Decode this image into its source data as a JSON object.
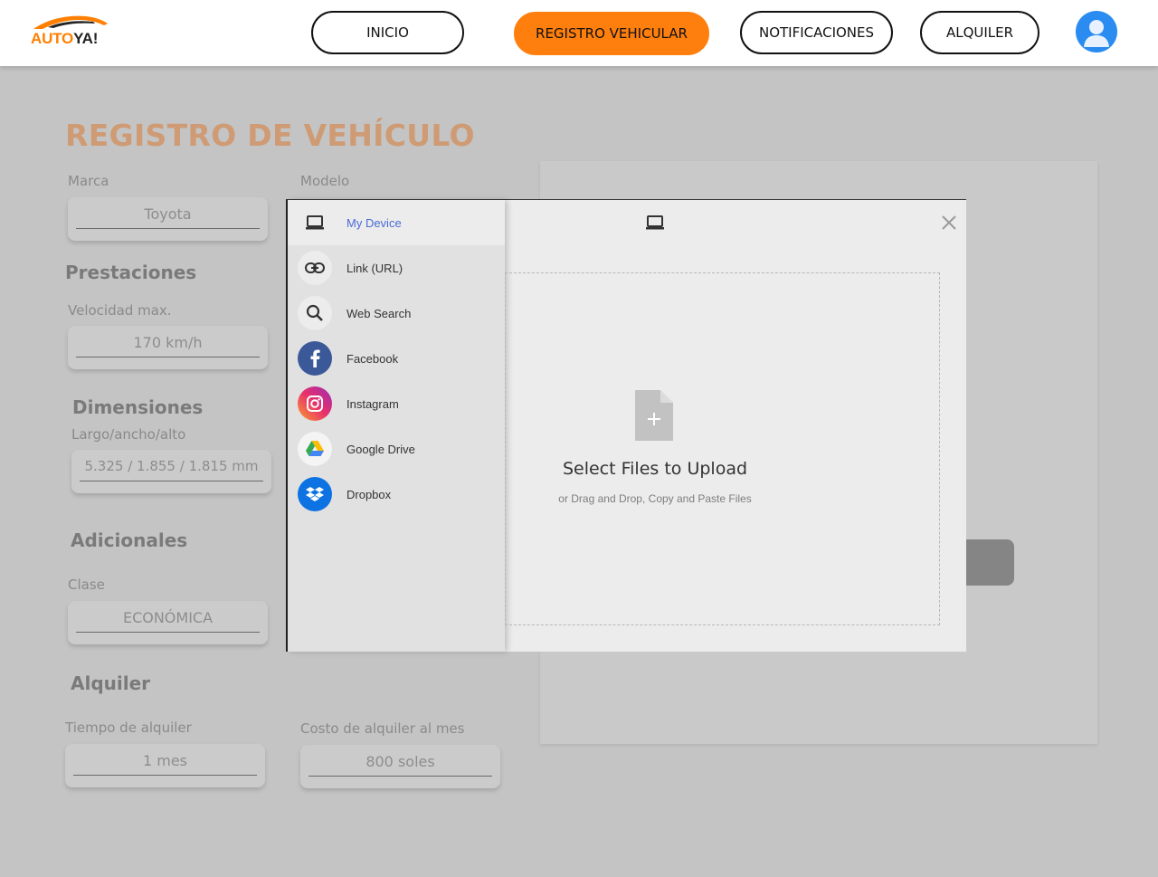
{
  "header": {
    "logo_part1": "AUTO",
    "logo_part2": "YA!",
    "nav": [
      {
        "label": "INICIO",
        "active": false
      },
      {
        "label": "REGISTRO VEHICULAR",
        "active": true
      },
      {
        "label": "NOTIFICACIONES",
        "active": false
      },
      {
        "label": "ALQUILER",
        "active": false
      }
    ],
    "accent_color": "#ff7f0e"
  },
  "form": {
    "title": "REGISTRO DE VEHÍCULO",
    "marca_label": "Marca",
    "marca_value": "Toyota",
    "modelo_label": "Modelo",
    "prestaciones_heading": "Prestaciones",
    "velocidad_label": "Velocidad max.",
    "velocidad_value": "170 km/h",
    "dimensiones_heading": "Dimensiones",
    "dimensiones_label": "Largo/ancho/alto",
    "dimensiones_value": "5.325 / 1.855 / 1.815 mm",
    "adicionales_heading": "Adicionales",
    "clase_label": "Clase",
    "clase_value": "ECONÓMICA",
    "alquiler_heading": "Alquiler",
    "tiempo_label": "Tiempo de alquiler",
    "tiempo_value": "1 mes",
    "costo_label": "Costo de alquiler al mes",
    "costo_value": "800 soles"
  },
  "upload_modal": {
    "sources": [
      {
        "label": "My Device",
        "icon": "laptop-icon",
        "active": true
      },
      {
        "label": "Link (URL)",
        "icon": "link-icon",
        "active": false
      },
      {
        "label": "Web Search",
        "icon": "search-icon",
        "active": false
      },
      {
        "label": "Facebook",
        "icon": "facebook-icon",
        "active": false
      },
      {
        "label": "Instagram",
        "icon": "instagram-icon",
        "active": false
      },
      {
        "label": "Google Drive",
        "icon": "google-drive-icon",
        "active": false
      },
      {
        "label": "Dropbox",
        "icon": "dropbox-icon",
        "active": false
      }
    ],
    "select_title": "Select Files to Upload",
    "select_subtitle": "or Drag and Drop, Copy and Paste Files"
  }
}
